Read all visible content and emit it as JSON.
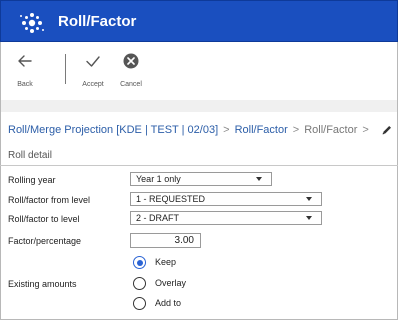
{
  "app": {
    "title": "Roll/Factor",
    "brand_color": "#1a4fbf",
    "logo_icon": "dots-sparkle-icon"
  },
  "toolbar": {
    "back": {
      "label": "Back",
      "icon": "arrow-left-icon"
    },
    "accept": {
      "label": "Accept",
      "icon": "check-icon"
    },
    "cancel": {
      "label": "Cancel",
      "icon": "close-circle-icon"
    }
  },
  "breadcrumb": {
    "items": [
      "Roll/Merge Projection [KDE | TEST | 02/03]",
      "Roll/Factor",
      "Roll/Factor"
    ],
    "separator": ">",
    "edit_icon": "pencil-icon"
  },
  "section": {
    "title": "Roll detail"
  },
  "form": {
    "rolling_year": {
      "label": "Rolling year",
      "value": "Year 1 only"
    },
    "from_level": {
      "label": "Roll/factor from level",
      "value": "1 - REQUESTED"
    },
    "to_level": {
      "label": "Roll/factor to level",
      "value": "2 - DRAFT"
    },
    "factor": {
      "label": "Factor/percentage",
      "value": "3.00"
    },
    "existing_amounts": {
      "label": "Existing amounts",
      "options": [
        "Keep",
        "Overlay",
        "Add to"
      ],
      "selected": "Keep"
    }
  }
}
